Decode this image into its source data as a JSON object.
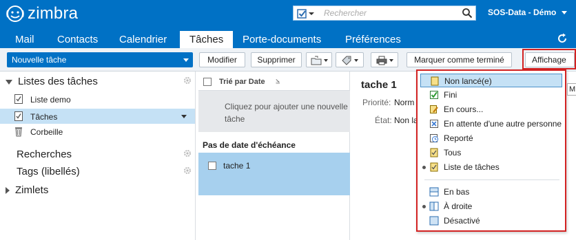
{
  "app": {
    "logo_text": "zimbra"
  },
  "search": {
    "placeholder": "Rechercher"
  },
  "user": {
    "name": "SOS-Data - Démo"
  },
  "tabs": [
    {
      "label": "Mail"
    },
    {
      "label": "Contacts"
    },
    {
      "label": "Calendrier"
    },
    {
      "label": "Tâches",
      "active": true
    },
    {
      "label": "Porte-documents"
    },
    {
      "label": "Préférences"
    }
  ],
  "toolbar": {
    "new_task": "Nouvelle tâche",
    "modify": "Modifier",
    "delete": "Supprimer",
    "mark_done": "Marquer comme terminé",
    "view": "Affichage"
  },
  "sidebar": {
    "task_lists_header": "Listes des tâches",
    "items": [
      {
        "label": "Liste demo"
      },
      {
        "label": "Tâches",
        "selected": true
      },
      {
        "label": "Corbeille"
      }
    ],
    "searches": "Recherches",
    "tags": "Tags (libellés)",
    "zimlets": "Zimlets"
  },
  "list": {
    "sort_label": "Trié par Date",
    "add_hint": "Cliquez pour ajouter une nouvelle tâche",
    "group_header": "Pas de date d'échéance",
    "rows": [
      {
        "title": "tache 1"
      }
    ]
  },
  "reading": {
    "title": "tache 1",
    "priority_label": "Priorité:",
    "priority_value": "Norm",
    "status_label": "État:",
    "status_value": "Non la"
  },
  "menu": {
    "items": [
      {
        "label": "Non lancé(e)",
        "icon": "not-started-icon",
        "highlighted": true
      },
      {
        "label": "Fini",
        "icon": "done-icon"
      },
      {
        "label": "En cours...",
        "icon": "in-progress-icon"
      },
      {
        "label": "En attente d'une autre personne",
        "icon": "waiting-icon"
      },
      {
        "label": "Reporté",
        "icon": "deferred-icon"
      },
      {
        "label": "Tous",
        "icon": "all-icon"
      },
      {
        "label": "Liste de tâches",
        "icon": "task-list-icon",
        "radio": true
      }
    ],
    "pane_items": [
      {
        "label": "En bas",
        "icon": "pane-bottom-icon"
      },
      {
        "label": "À droite",
        "icon": "pane-right-icon",
        "radio": true
      },
      {
        "label": "Désactivé",
        "icon": "pane-off-icon"
      }
    ]
  },
  "tooltip_char": "M",
  "colors": {
    "brand": "#0071c5",
    "selection": "#c5e1f5",
    "task_row": "#a7d0ee",
    "highlight_border": "#d32222"
  }
}
